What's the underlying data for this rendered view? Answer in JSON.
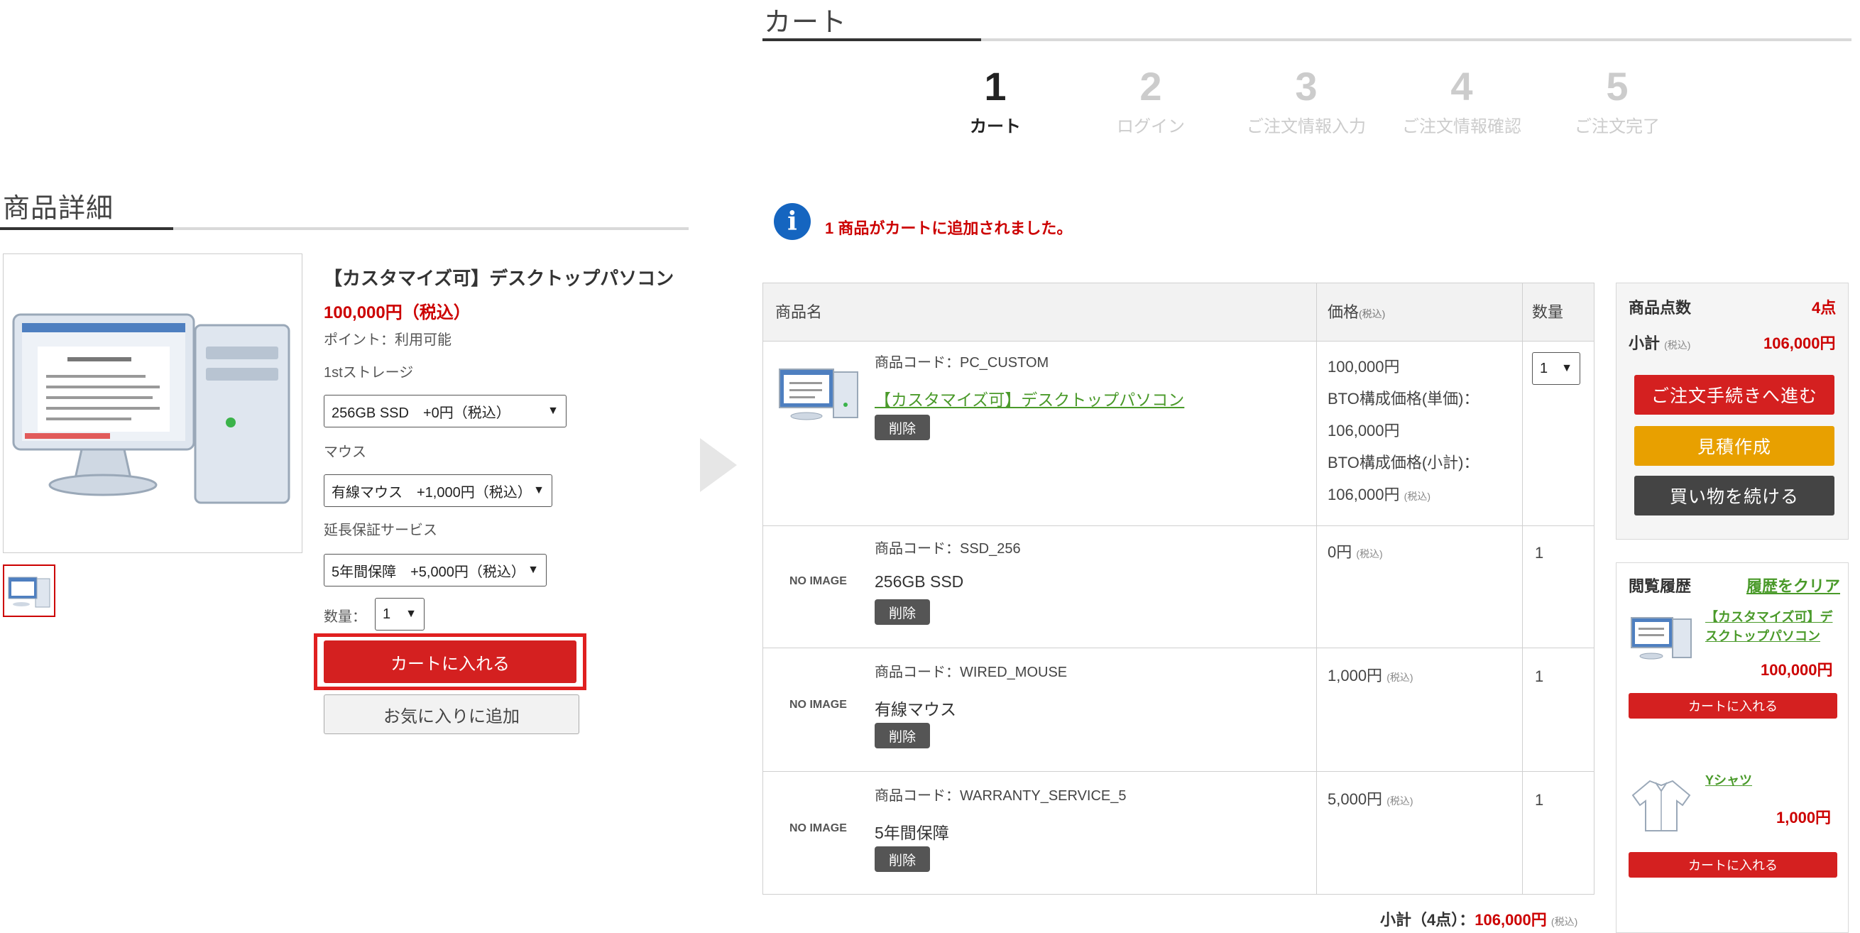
{
  "left": {
    "section_title": "商品詳細",
    "product_name": "【カスタマイズ可】デスクトップパソコン",
    "price": "100,000円（税込）",
    "points": "ポイント：利用可能",
    "opt1_label": "1stストレージ",
    "opt1_value": "256GB SSD　+0円（税込）",
    "opt2_label": "マウス",
    "opt2_value": "有線マウス　+1,000円（税込）",
    "opt3_label": "延長保証サービス",
    "opt3_value": "5年間保障　+5,000円（税込）",
    "qty_label": "数量：",
    "qty_value": "1",
    "add_to_cart": "カートに入れる",
    "add_favorite": "お気に入りに追加"
  },
  "cart": {
    "section_title": "カート",
    "steps": [
      {
        "num": "1",
        "name": "カート"
      },
      {
        "num": "2",
        "name": "ログイン"
      },
      {
        "num": "3",
        "name": "ご注文情報入力"
      },
      {
        "num": "4",
        "name": "ご注文情報確認"
      },
      {
        "num": "5",
        "name": "ご注文完了"
      }
    ],
    "message": "1 商品がカートに追加されました。",
    "headers": {
      "name": "商品名",
      "price": "価格",
      "price_tax": "(税込)",
      "qty": "数量"
    },
    "rows": [
      {
        "code": "商品コード：PC_CUSTOM",
        "name": "【カスタマイズ可】デスクトップパソコン",
        "delete": "削除",
        "price_lines": [
          "100,000円",
          "BTO構成価格(単価)：",
          "106,000円",
          "BTO構成価格(小計)：",
          "106,000円"
        ],
        "tax_note": "(税込)",
        "qty": "1"
      },
      {
        "noimage": "NO IMAGE",
        "code": "商品コード：SSD_256",
        "name": "256GB SSD",
        "delete": "削除",
        "price": "0円",
        "tax_note": "(税込)",
        "qty": "1"
      },
      {
        "noimage": "NO IMAGE",
        "code": "商品コード：WIRED_MOUSE",
        "name": "有線マウス",
        "delete": "削除",
        "price": "1,000円",
        "tax_note": "(税込)",
        "qty": "1"
      },
      {
        "noimage": "NO IMAGE",
        "code": "商品コード：WARRANTY_SERVICE_5",
        "name": "5年間保障",
        "delete": "削除",
        "price": "5,000円",
        "tax_note": "(税込)",
        "qty": "1"
      }
    ],
    "subtotal_label": "小計（4点）：",
    "subtotal_value": "106,000円",
    "subtotal_tax": "(税込)"
  },
  "summary": {
    "count_label": "商品点数",
    "count_value": "4点",
    "subtotal_label": "小計",
    "subtotal_tax": "(税込)",
    "subtotal_value": "106,000円",
    "checkout": "ご注文手続きへ進む",
    "estimate": "見積作成",
    "continue": "買い物を続ける",
    "colors": {
      "checkout": "#d42020",
      "estimate": "#e8a000",
      "continue": "#444444"
    }
  },
  "history": {
    "title": "閲覧履歴",
    "clear": "履歴をクリア",
    "items": [
      {
        "name": "【カスタマイズ可】デスクトップパソコン",
        "price": "100,000円",
        "button": "カートに入れる",
        "icon": "desktop-pc"
      },
      {
        "name": "Yシャツ",
        "price": "1,000円",
        "button": "カートに入れる",
        "icon": "shirt"
      }
    ]
  }
}
